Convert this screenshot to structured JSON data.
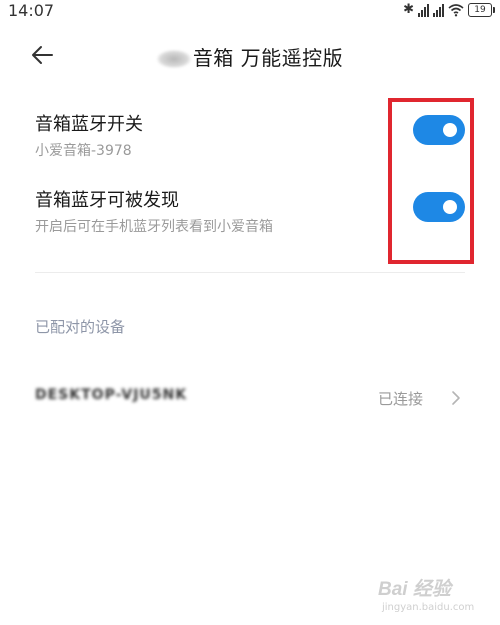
{
  "status_bar": {
    "time": "14:07",
    "battery": "19",
    "bluetooth_icon": "bluetooth-icon",
    "wifi_icon": "wifi-icon"
  },
  "header": {
    "title": "音箱 万能遥控版",
    "back_icon": "arrow-left-icon"
  },
  "settings": [
    {
      "title": "音箱蓝牙开关",
      "subtitle": "小爱音箱-3978",
      "enabled": true
    },
    {
      "title": "音箱蓝牙可被发现",
      "subtitle": "开启后可在手机蓝牙列表看到小爱音箱",
      "enabled": true
    }
  ],
  "paired_section": {
    "header": "已配对的设备",
    "devices": [
      {
        "name": "DESKTOP-VJU5NK",
        "status": "已连接"
      }
    ]
  },
  "colors": {
    "toggle_on": "#1e88e5",
    "highlight": "#e0262f",
    "section_header": "#8e96a8"
  },
  "watermark": {
    "logo": "Bai 经验",
    "url": "jingyan.baidu.com"
  }
}
